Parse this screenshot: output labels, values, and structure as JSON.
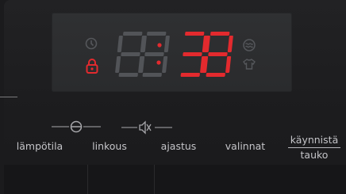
{
  "display": {
    "time_hours": "88",
    "time_minutes": "38",
    "hours_state": "inactive",
    "minutes_state": "active"
  },
  "indicators": {
    "clock": "clock-icon",
    "child_lock": "lock-icon",
    "rinse": "rinse-icon",
    "shirt": "shirt-icon"
  },
  "buttons": [
    {
      "label": "lämpötila"
    },
    {
      "label": "linkous"
    },
    {
      "label": "ajastus"
    },
    {
      "label": "valinnat"
    },
    {
      "label_top": "käynnistä",
      "label_bottom": "tauko"
    }
  ],
  "symbols": {
    "spin": "spin-drum-icon",
    "mute": "speaker-mute-icon"
  },
  "colors": {
    "active_segment": "#e32a2e",
    "inactive_segment": "#525458",
    "lock_active": "#e32a2e",
    "label": "#c4c4c8"
  }
}
